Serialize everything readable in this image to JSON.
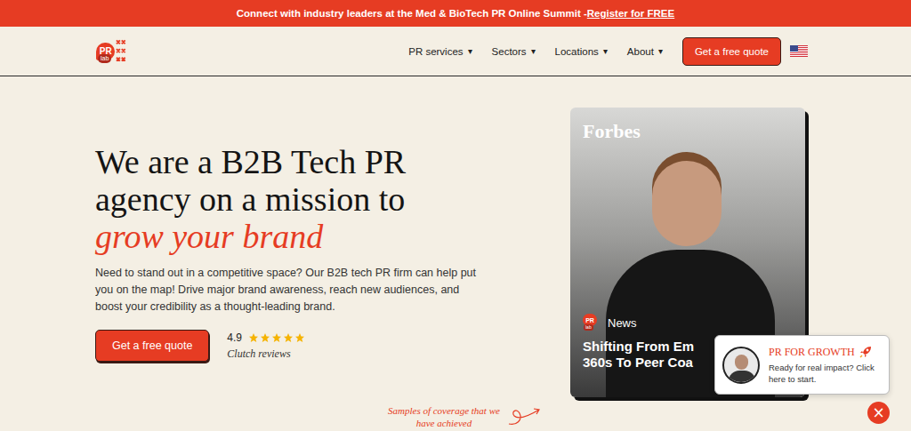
{
  "banner": {
    "text": "Connect with industry leaders at the Med & BioTech PR Online Summit - ",
    "link": "Register for FREE"
  },
  "logo": {
    "text": "PR",
    "sub": "lab"
  },
  "nav": {
    "items": [
      {
        "label": "PR services",
        "caret": "▾"
      },
      {
        "label": "Sectors",
        "caret": "▾"
      },
      {
        "label": "Locations",
        "caret": "▾"
      },
      {
        "label": "About",
        "caret": "▾"
      }
    ],
    "cta": "Get a free quote"
  },
  "hero": {
    "headline": [
      "We are a B2B Tech PR",
      "agency on a mission to"
    ],
    "highlight": "grow your brand",
    "body": "Need to stand out in a competitive space? Our B2B tech PR firm can help put you on the map! Drive major brand awareness, reach new audiences, and boost your credibility as a thought-leading brand.",
    "cta": "Get a free quote",
    "rating": {
      "score": "4.9",
      "stars": 5,
      "source": "Clutch reviews"
    }
  },
  "coverage_card": {
    "outlet": "Forbes",
    "tag": "News",
    "tag_logo": "PR",
    "tag_logo_sub": "lab",
    "headline": [
      "Shifting From Em",
      "360s To Peer Coa"
    ]
  },
  "coverage_caption": [
    "Samples of coverage that we",
    "have achieved"
  ],
  "chat": {
    "title": "PR FOR GROWTH",
    "message": "Ready for real impact? Click here to start.",
    "close": "×"
  }
}
